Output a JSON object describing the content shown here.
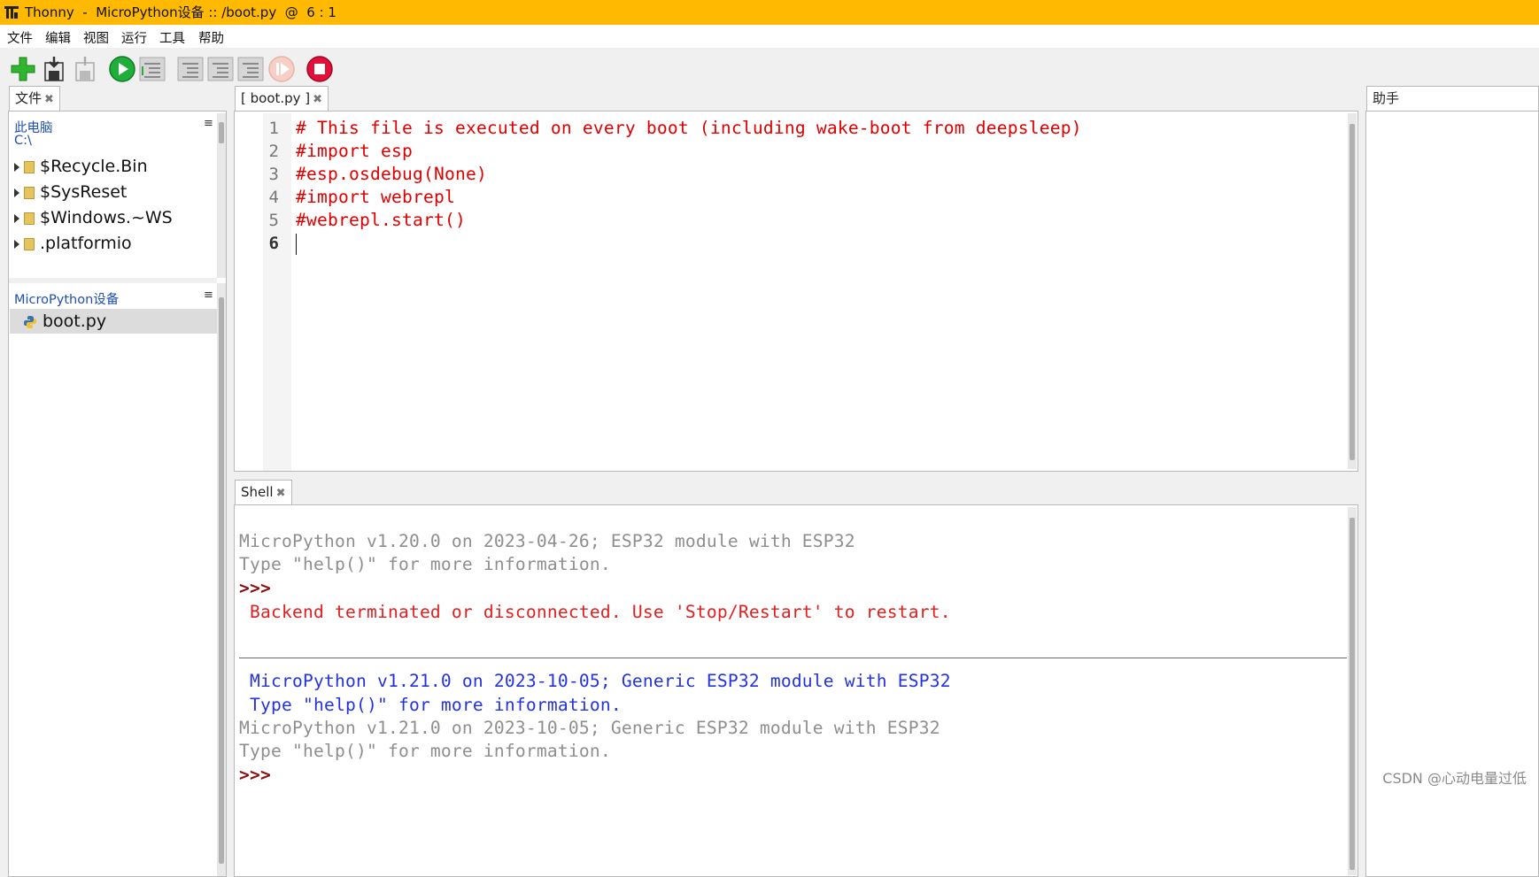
{
  "window": {
    "title": "Thonny  -  MicroPython设备 :: /boot.py  @  6 : 1"
  },
  "menu": [
    "文件",
    "编辑",
    "视图",
    "运行",
    "工具",
    "帮助"
  ],
  "toolbar": {
    "buttons": [
      "new-file",
      "save-file",
      "save-all",
      "run",
      "debug",
      "step-over",
      "step-into",
      "step-out",
      "resume",
      "stop"
    ],
    "colors": {
      "new": "#2fb52f",
      "run": "#1fae3a",
      "stop": "#e0103a"
    }
  },
  "files_panel": {
    "tab_label": "文件",
    "computer_section": {
      "title": "此电脑",
      "path": "C:\\"
    },
    "items": [
      "$Recycle.Bin",
      "$SysReset",
      "$Windows.~WS",
      ".platformio"
    ],
    "device_section": {
      "title": "MicroPython设备",
      "items": [
        "boot.py"
      ]
    }
  },
  "editor": {
    "tab_label": "[ boot.py ]",
    "cursor_line": 6,
    "lines": [
      {
        "num": "1",
        "text": "# This file is executed on every boot (including wake-boot from deepsleep)"
      },
      {
        "num": "2",
        "text": "#import esp"
      },
      {
        "num": "3",
        "text": "#esp.osdebug(None)"
      },
      {
        "num": "4",
        "text": "#import webrepl"
      },
      {
        "num": "5",
        "text": "#webrepl.start()"
      },
      {
        "num": "6",
        "text": ""
      }
    ]
  },
  "shell": {
    "tab_label": "Shell",
    "line1": "MicroPython v1.20.0 on 2023-04-26; ESP32 module with ESP32",
    "line2": "Type \"help()\" for more information.",
    "prompt1": ">>>",
    "error": " Backend terminated or disconnected. Use 'Stop/Restart' to restart.",
    "line3": " MicroPython v1.21.0 on 2023-10-05; Generic ESP32 module with ESP32",
    "line4": " Type \"help()\" for more information.",
    "line5": "MicroPython v1.21.0 on 2023-10-05; Generic ESP32 module with ESP32",
    "line6": "Type \"help()\" for more information.",
    "prompt2": ">>>"
  },
  "assistant_tab": {
    "label": "助手"
  },
  "watermark": "CSDN @心动电量过低"
}
